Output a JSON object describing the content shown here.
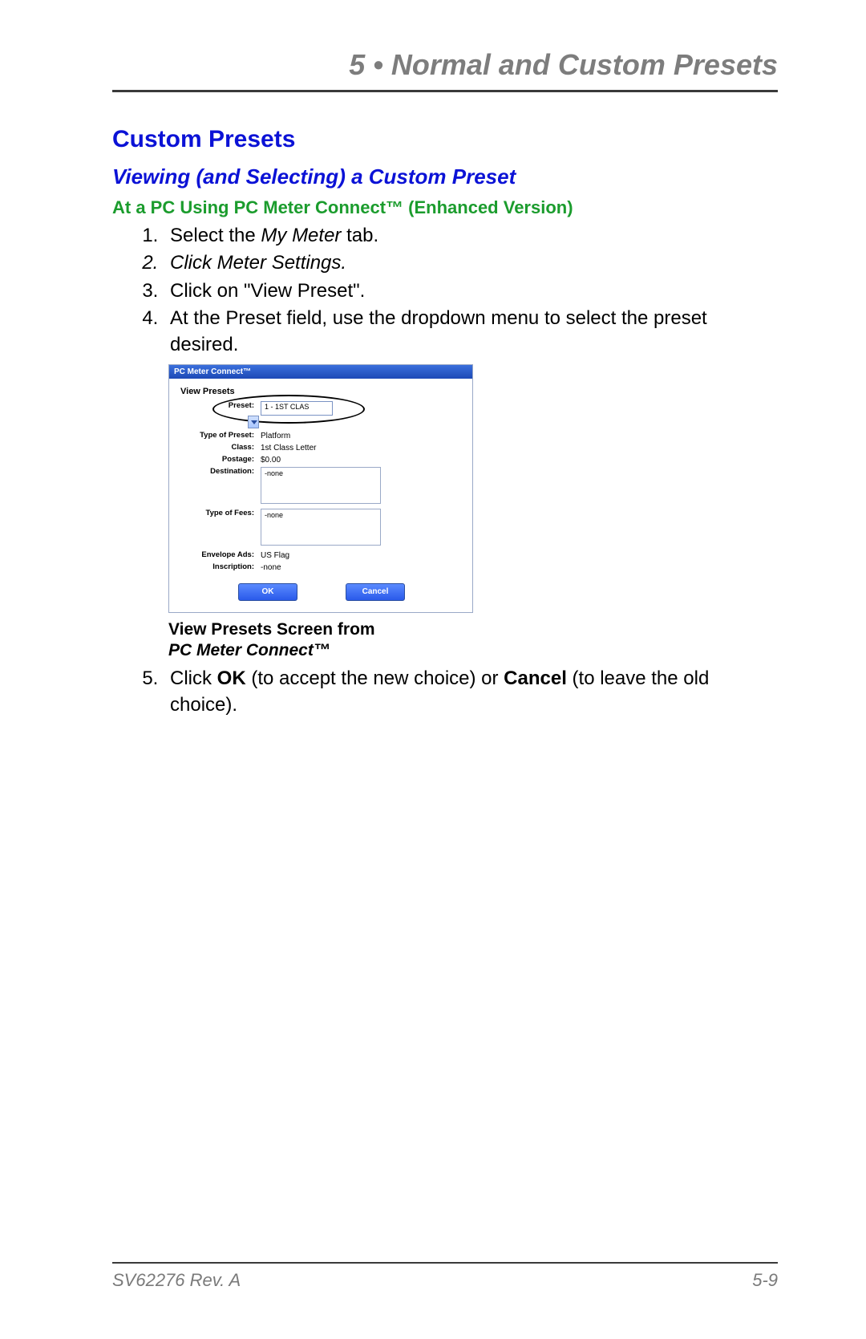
{
  "chapter": {
    "title": "5 • Normal and Custom Presets"
  },
  "section": {
    "heading": "Custom Presets"
  },
  "subsection": {
    "heading": "Viewing (and Selecting) a Custom Preset"
  },
  "method": {
    "heading": "At a PC Using PC Meter Connect™ (Enhanced Version)"
  },
  "steps": {
    "s1a": "Select the ",
    "s1b": "My Meter",
    "s1c": " tab.",
    "s2a": "Click ",
    "s2b": "Meter Settings.",
    "s3": "Click on \"View Preset\".",
    "s4": "At the Preset field, use the dropdown menu to select the preset desired.",
    "s5a": "Click ",
    "s5b": "OK",
    "s5c": " (to accept the new choice) or ",
    "s5d": "Cancel",
    "s5e": " (to leave the old choice)."
  },
  "screenshot": {
    "titlebar": "PC Meter Connect™",
    "subtitle": "View Presets",
    "labels": {
      "preset": "Preset:",
      "type_of_preset": "Type of Preset:",
      "class": "Class:",
      "postage": "Postage:",
      "destination": "Destination:",
      "type_of_fees": "Type of Fees:",
      "envelope_ads": "Envelope Ads:",
      "inscription": "Inscription:"
    },
    "values": {
      "preset_selected": "1 - 1ST CLAS",
      "type_of_preset": "Platform",
      "class": "1st Class Letter",
      "postage": "$0.00",
      "destination": "-none",
      "type_of_fees": "-none",
      "envelope_ads": "US Flag",
      "inscription": "-none"
    },
    "buttons": {
      "ok": "OK",
      "cancel": "Cancel"
    }
  },
  "caption": {
    "line1": "View Presets Screen from",
    "line2": "PC Meter Connect™"
  },
  "footer": {
    "doc_id": "SV62276 Rev. A",
    "page_no": "5-9"
  }
}
